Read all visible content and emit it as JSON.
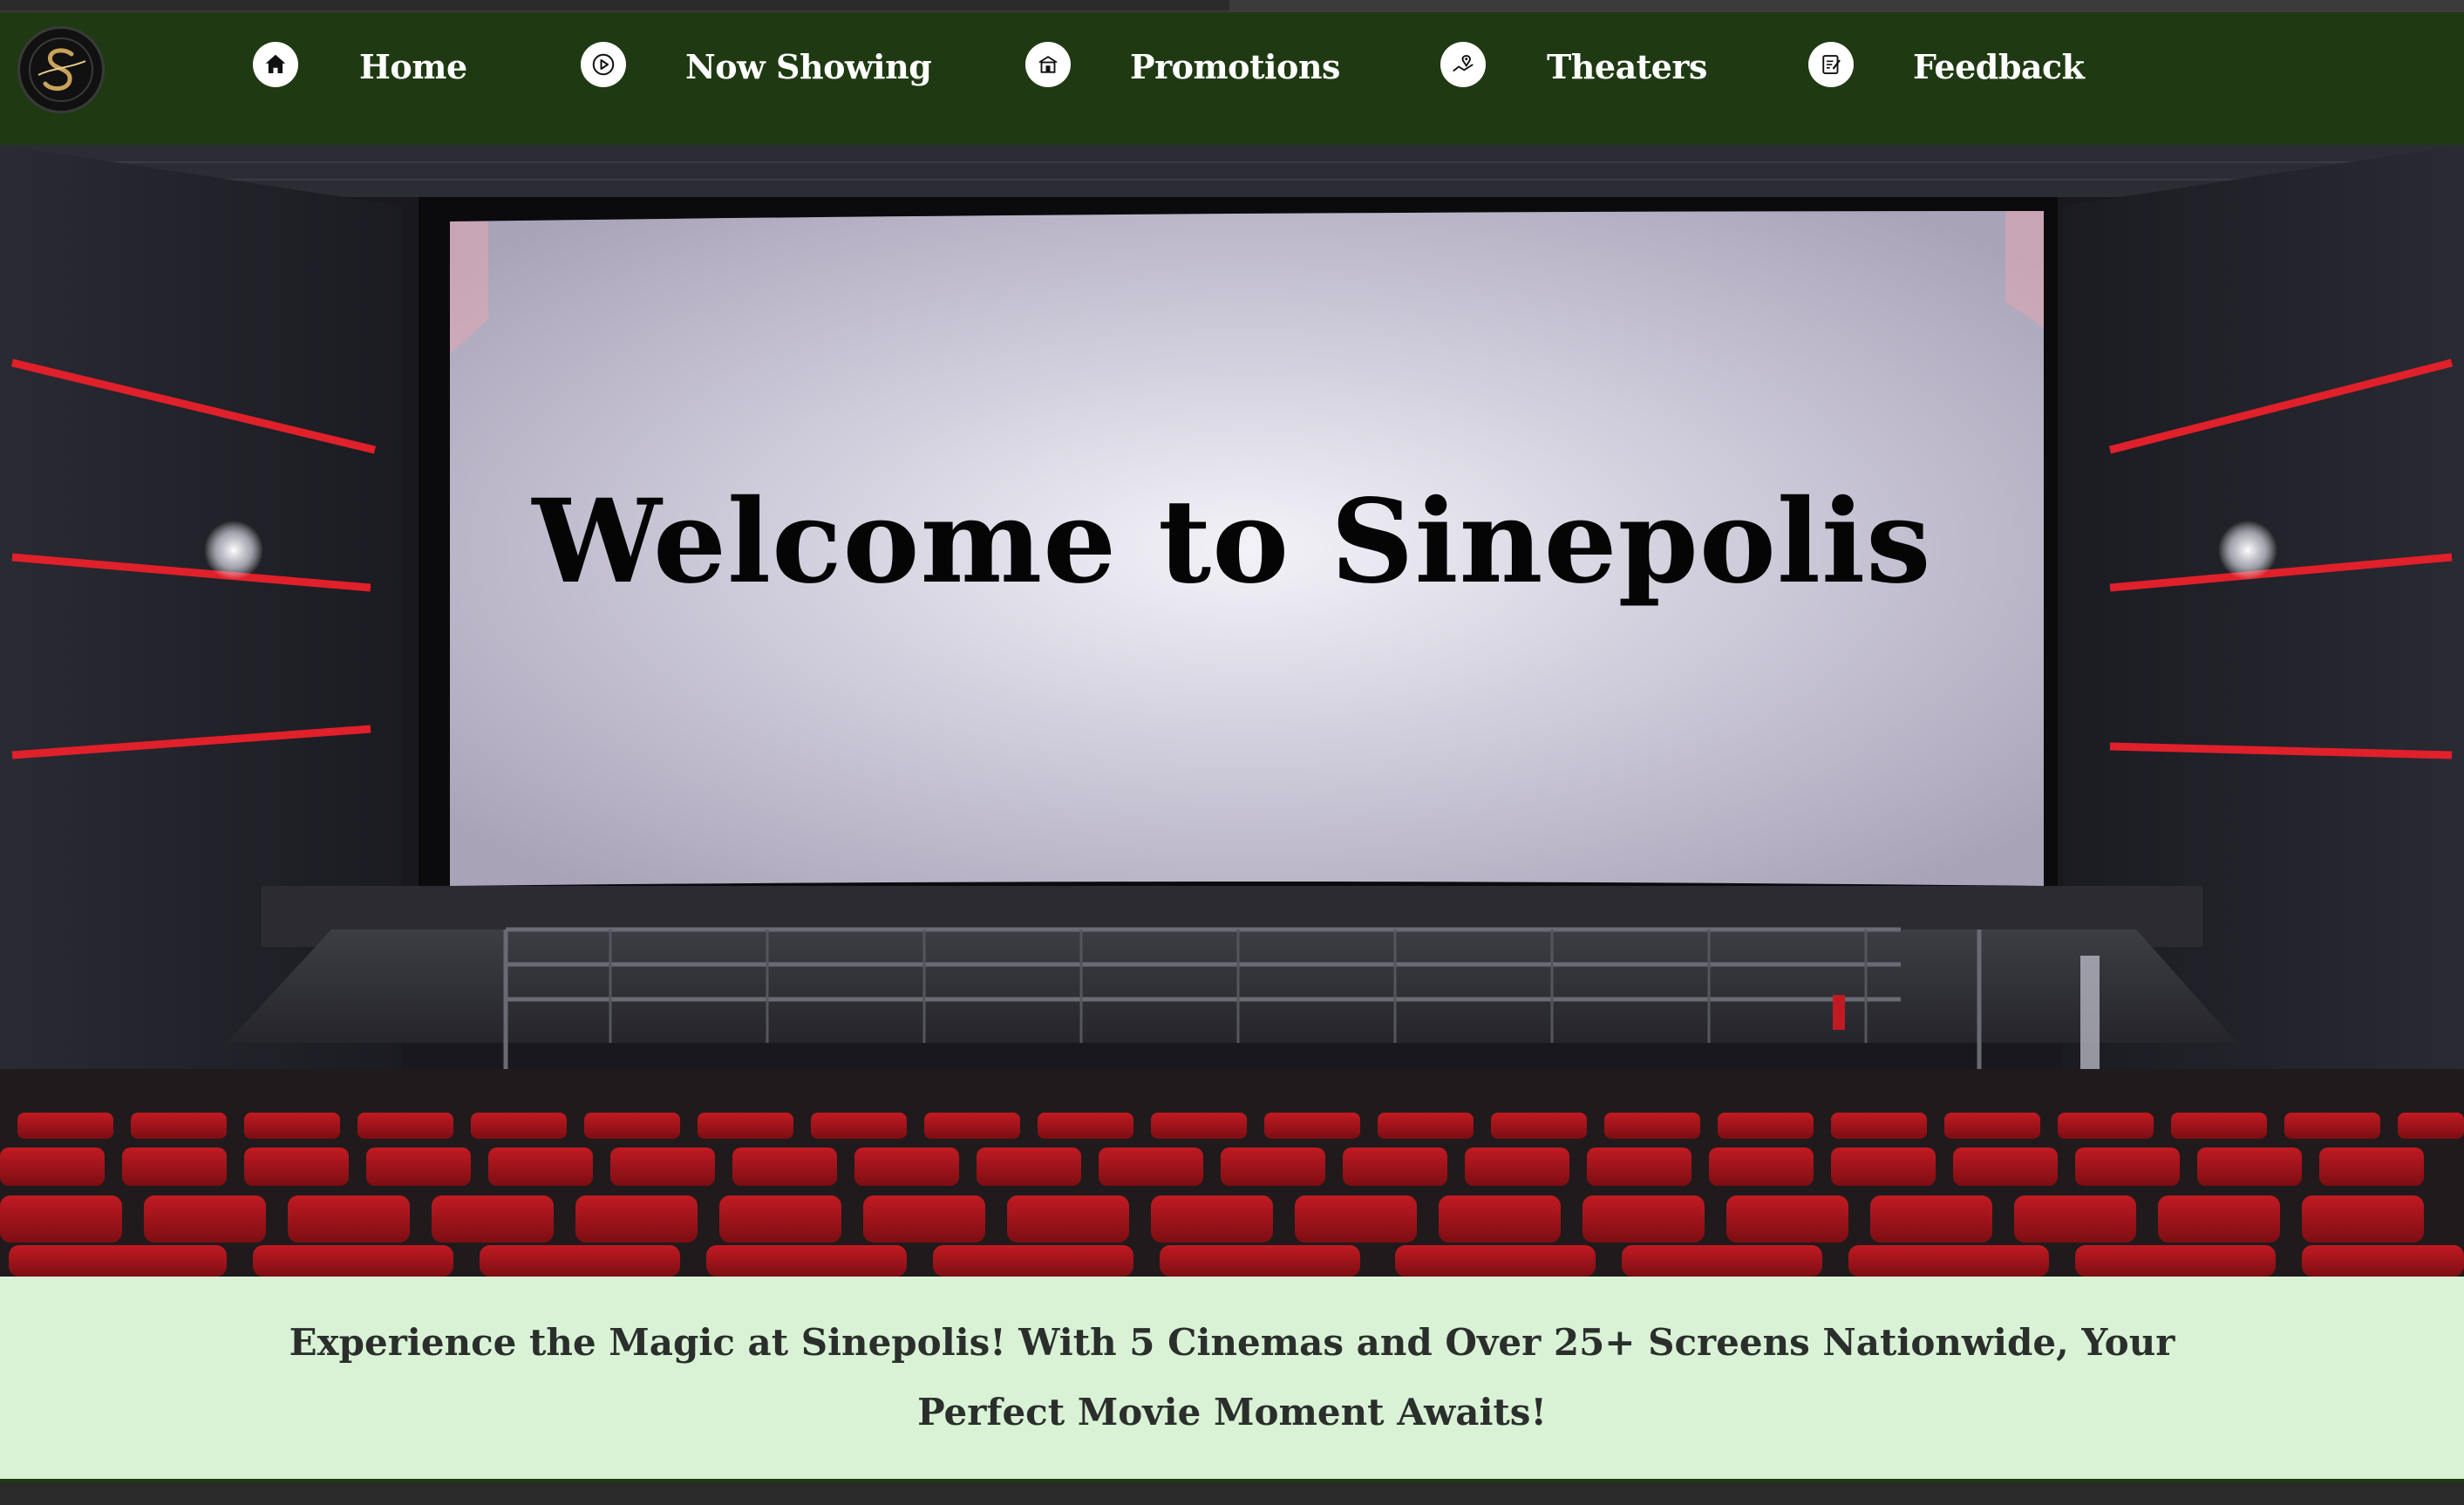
{
  "nav": {
    "logo_icon": "sinepolis-s-logo",
    "items": [
      {
        "label": "Home",
        "icon": "home-icon"
      },
      {
        "label": "Now Showing",
        "icon": "play-circle-icon"
      },
      {
        "label": "Promotions",
        "icon": "store-icon"
      },
      {
        "label": "Theaters",
        "icon": "map-pin-icon"
      },
      {
        "label": "Feedback",
        "icon": "clipboard-edit-icon"
      }
    ]
  },
  "hero": {
    "title": "Welcome to Sinepolis"
  },
  "tagline": {
    "text": "Experience the Magic at Sinepolis! With 5 Cinemas and Over 25+ Screens Nationwide, Your Perfect Movie Moment Awaits!"
  },
  "colors": {
    "nav_bg": "#1f3a12",
    "tagline_bg": "#d9f2d6",
    "seat_red": "#a3141c",
    "accent_red": "#e0202a"
  }
}
